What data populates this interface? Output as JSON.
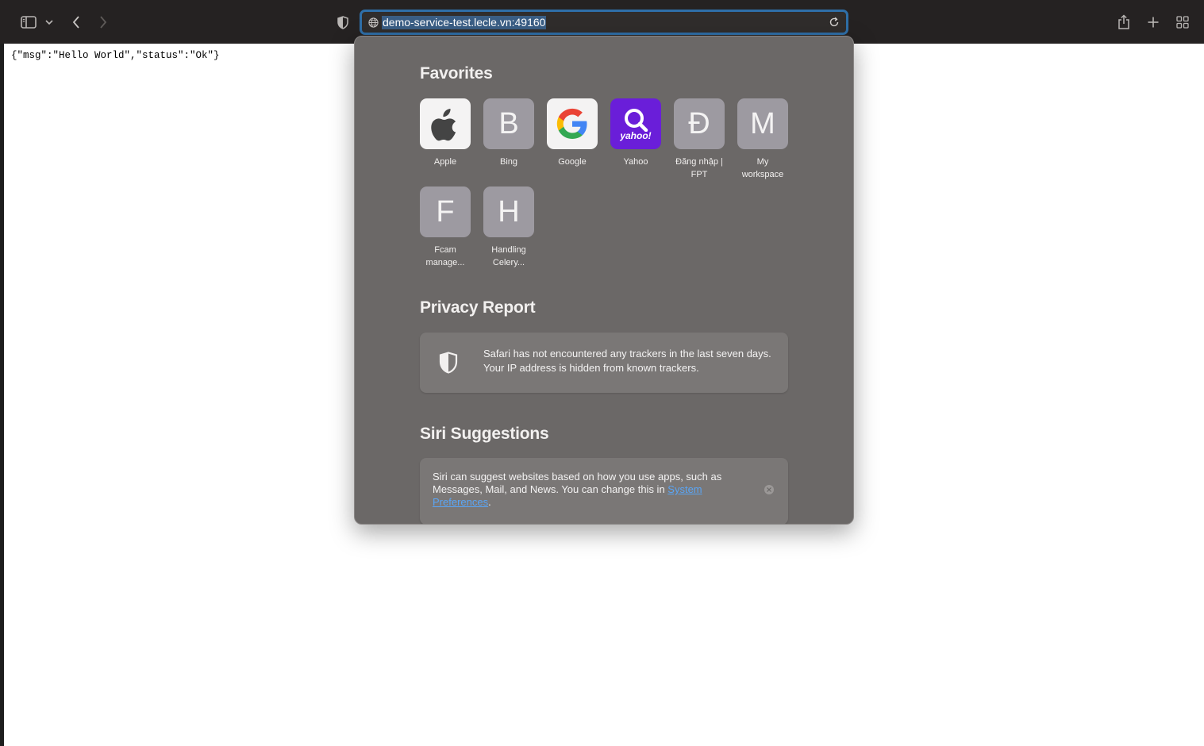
{
  "toolbar": {
    "url": "demo-service-test.lecle.vn:49160"
  },
  "page": {
    "json_text": "{\"msg\":\"Hello World\",\"status\":\"Ok\"}"
  },
  "popover": {
    "favorites_title": "Favorites",
    "favorites": [
      {
        "label": "Apple",
        "tile": "",
        "icon": "apple-logo-icon"
      },
      {
        "label": "Bing",
        "tile": "B"
      },
      {
        "label": "Google",
        "tile": "",
        "icon": "google-logo-icon"
      },
      {
        "label": "Yahoo",
        "tile": "yahoo!",
        "icon": "yahoo-logo-icon"
      },
      {
        "label": "Đăng nhập | FPT",
        "tile": "Đ"
      },
      {
        "label": "My workspace",
        "tile": "M"
      },
      {
        "label": "Fcam manage...",
        "tile": "F"
      },
      {
        "label": "Handling Celery...",
        "tile": "H"
      }
    ],
    "privacy_title": "Privacy Report",
    "privacy_text": "Safari has not encountered any trackers in the last seven days. Your IP address is hidden from known trackers.",
    "siri_title": "Siri Suggestions",
    "siri_text": "Siri can suggest websites based on how you use apps, such as Messages, Mail, and News. You can change this in ",
    "siri_link": "System Preferences",
    "siri_end": "."
  },
  "colors": {
    "toolbar_bg": "#252222",
    "address_focus": "#2f6fa8",
    "popover_bg": "#6b6867",
    "yahoo_purple": "#6a1ed9",
    "link_blue": "#5aa5f5"
  }
}
